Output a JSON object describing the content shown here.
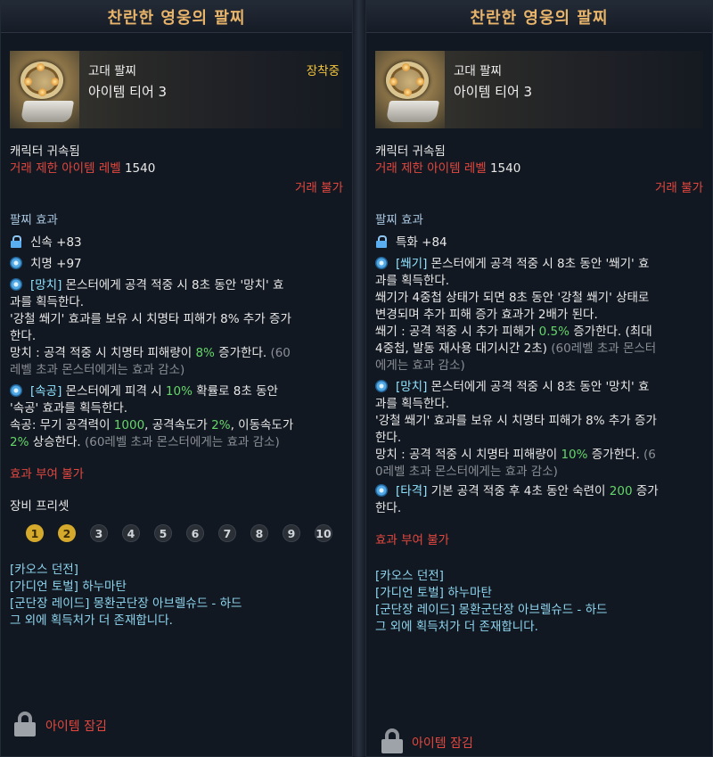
{
  "left": {
    "title": "찬란한 영웅의 팔찌",
    "grade": "고대 팔찌",
    "tier": "아이템 티어 3",
    "equipped": "장착중",
    "bound": "캐릭터 귀속됨",
    "level_label": "거래 제한 아이템 레벨",
    "level_value": "1540",
    "trade": "거래 불가",
    "effect_title": "팔찌 효과",
    "stats": [
      {
        "icon": "lock-icon",
        "text": "신속 +83"
      },
      {
        "icon": "swirl-icon",
        "text": "치명 +97"
      }
    ],
    "effect1": {
      "tag": "[망치]",
      "line1": " 몬스터에게 공격 적중 시 8초 동안 '망치' 효",
      "line2": "과를 획득한다.",
      "line3": "'강철 쐐기' 효과를 보유 시 치명타 피해가 8% 추가 증가",
      "line4": "한다.",
      "line5a": "망치 : 공격 적중 시 치명타 피해량이 ",
      "line5b": "8%",
      "line5c": " 증가한다.",
      "line5d": " (60",
      "line6": "레벨 초과 몬스터에게는 효과 감소)"
    },
    "effect2": {
      "tag": "[속공]",
      "line1a": " 몬스터에게 피격 시 ",
      "line1b": "10%",
      "line1c": " 확률로 8초 동안",
      "line2": "'속공' 효과를 획득한다.",
      "line3a": "속공: 무기 공격력이 ",
      "line3b": "1000",
      "line3c": ", 공격속도가 ",
      "line3d": "2%",
      "line3e": ", 이동속도가",
      "line4a": "2%",
      "line4b": " 상승한다.",
      "line4c": " (60레벨 초과 몬스터에게는 효과 감소)"
    },
    "no_effect": "효과 부여 불가",
    "preset_title": "장비 프리셋",
    "presets": [
      "1",
      "2",
      "3",
      "4",
      "5",
      "6",
      "7",
      "8",
      "9",
      "10"
    ],
    "sources": [
      "[카오스 던전]",
      "[가디언 토벌] 하누마탄",
      "[군단장 레이드] 몽환군단장 아브렐슈드 - 하드",
      "그 외에 획득처가 더 존재합니다."
    ],
    "lock_label": "아이템 잠김"
  },
  "right": {
    "title": "찬란한 영웅의 팔찌",
    "grade": "고대 팔찌",
    "tier": "아이템 티어 3",
    "bound": "캐릭터 귀속됨",
    "level_label": "거래 제한 아이템 레벨",
    "level_value": "1540",
    "trade": "거래 불가",
    "effect_title": "팔찌 효과",
    "stat": "특화 +84",
    "effect1": {
      "tag": "[쐐기]",
      "line1": " 몬스터에게 공격 적중 시 8초 동안 '쐐기' 효",
      "line2": "과를 획득한다.",
      "line3": "쐐기가 4중첩 상태가 되면 8초 동안 '강철 쐐기' 상태로",
      "line4": "변경되며 추가 피해 증가 효과가 2배가 된다.",
      "line5a": "쐐기 : 공격 적중 시 추가 피해가 ",
      "line5b": "0.5%",
      "line5c": " 증가한다. (최대",
      "line6a": "4중첩, 발동 재사용 대기시간 2초)",
      "line6b": " (60레벨 초과 몬스터",
      "line7": "에게는 효과 감소)"
    },
    "effect2": {
      "tag": "[망치]",
      "line1": " 몬스터에게 공격 적중 시 8초 동안 '망치' 효",
      "line2": "과를 획득한다.",
      "line3": "'강철 쐐기' 효과를 보유 시 치명타 피해가 8% 추가 증가",
      "line4": "한다.",
      "line5a": "망치 : 공격 적중 시 치명타 피해량이 ",
      "line5b": "10%",
      "line5c": " 증가한다.",
      "line5d": " (6",
      "line6": "0레벨 초과 몬스터에게는 효과 감소)"
    },
    "effect3": {
      "tag": "[타격]",
      "line1a": " 기본 공격 적중 후 4초 동안 숙련이 ",
      "line1b": "200",
      "line1c": " 증가",
      "line2": "한다."
    },
    "no_effect": "효과 부여 불가",
    "sources": [
      "[카오스 던전]",
      "[가디언 토벌] 하누마탄",
      "[군단장 레이드] 몽환군단장 아브렐슈드 - 하드",
      "그 외에 획득처가 더 존재합니다."
    ],
    "lock_label": "아이템 잠김"
  }
}
